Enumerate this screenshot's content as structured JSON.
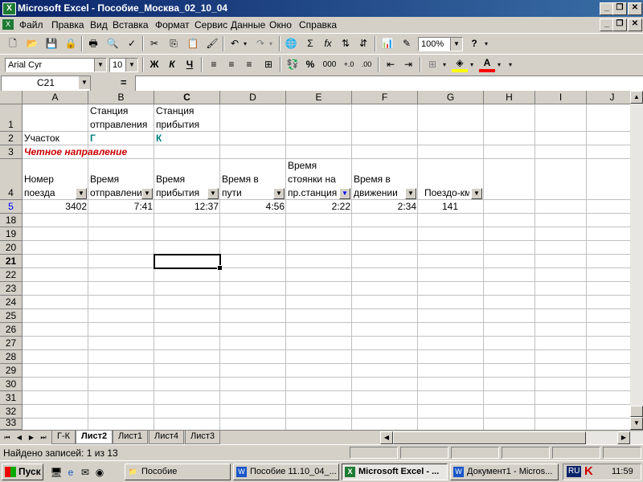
{
  "window": {
    "title": "Microsoft Excel - Пособие_Москва_02_10_04",
    "minimize": "_",
    "restore": "❐",
    "close": "✕"
  },
  "menu": [
    "Файл",
    "Правка",
    "Вид",
    "Вставка",
    "Формат",
    "Сервис",
    "Данные",
    "Окно",
    "Справка"
  ],
  "toolbar": {
    "zoom": "100%",
    "font_name": "Arial Cyr",
    "font_size": "10",
    "bold": "Ж",
    "italic": "К",
    "underline": "Ч",
    "percent": "%",
    "thousands": "000",
    "sum": "Σ",
    "fx": "fx",
    "help": "?"
  },
  "formula_bar": {
    "name_box": "C21",
    "equals": "=",
    "value": ""
  },
  "columns": [
    "A",
    "B",
    "C",
    "D",
    "E",
    "F",
    "G",
    "H",
    "I",
    "J"
  ],
  "rows": [
    "1",
    "2",
    "3",
    "4",
    "5",
    "18",
    "19",
    "20",
    "21",
    "22",
    "23",
    "24",
    "25",
    "26",
    "27",
    "28",
    "29",
    "30",
    "31",
    "32",
    "33"
  ],
  "cells": {
    "B1": [
      "Станция",
      "отправления"
    ],
    "C1": [
      "Станция",
      "прибытия"
    ],
    "A2": "Участок",
    "B2": "Г",
    "C2": "К",
    "A3": "Четное направление",
    "A4": [
      "Номер",
      "поезда"
    ],
    "B4": [
      "Время",
      "отправлени"
    ],
    "C4": [
      "Время",
      "прибытия"
    ],
    "D4": [
      "Время в",
      "пути"
    ],
    "E4": [
      "Время",
      "стоянки на",
      "пр.станция"
    ],
    "F4": [
      "Время в",
      "движении"
    ],
    "G4": "Поездо-км",
    "A5": "3402",
    "B5": "7:41",
    "C5": "12:37",
    "D5": "4:56",
    "E5": "2:22",
    "F5": "2:34",
    "G5": "141"
  },
  "sheets": [
    "Г-К",
    "Лист2",
    "Лист1",
    "Лист4",
    "Лист3"
  ],
  "active_sheet": "Лист2",
  "status": "Найдено записей: 1 из 13",
  "taskbar": {
    "start": "Пуск",
    "tasks": [
      {
        "label": "Пособие",
        "active": false
      },
      {
        "label": "Пособие 11.10_04_...",
        "active": false
      },
      {
        "label": "Microsoft Excel - ...",
        "active": true
      },
      {
        "label": "Документ1 - Micros...",
        "active": false
      }
    ],
    "lang": "RU",
    "clock": "11:59"
  },
  "colors": {
    "title_start": "#0a246a",
    "title_end": "#3a6ea5",
    "teal_text": "#008080",
    "red_text": "#cc0000",
    "filter_arrow_active": "#0000ff"
  }
}
